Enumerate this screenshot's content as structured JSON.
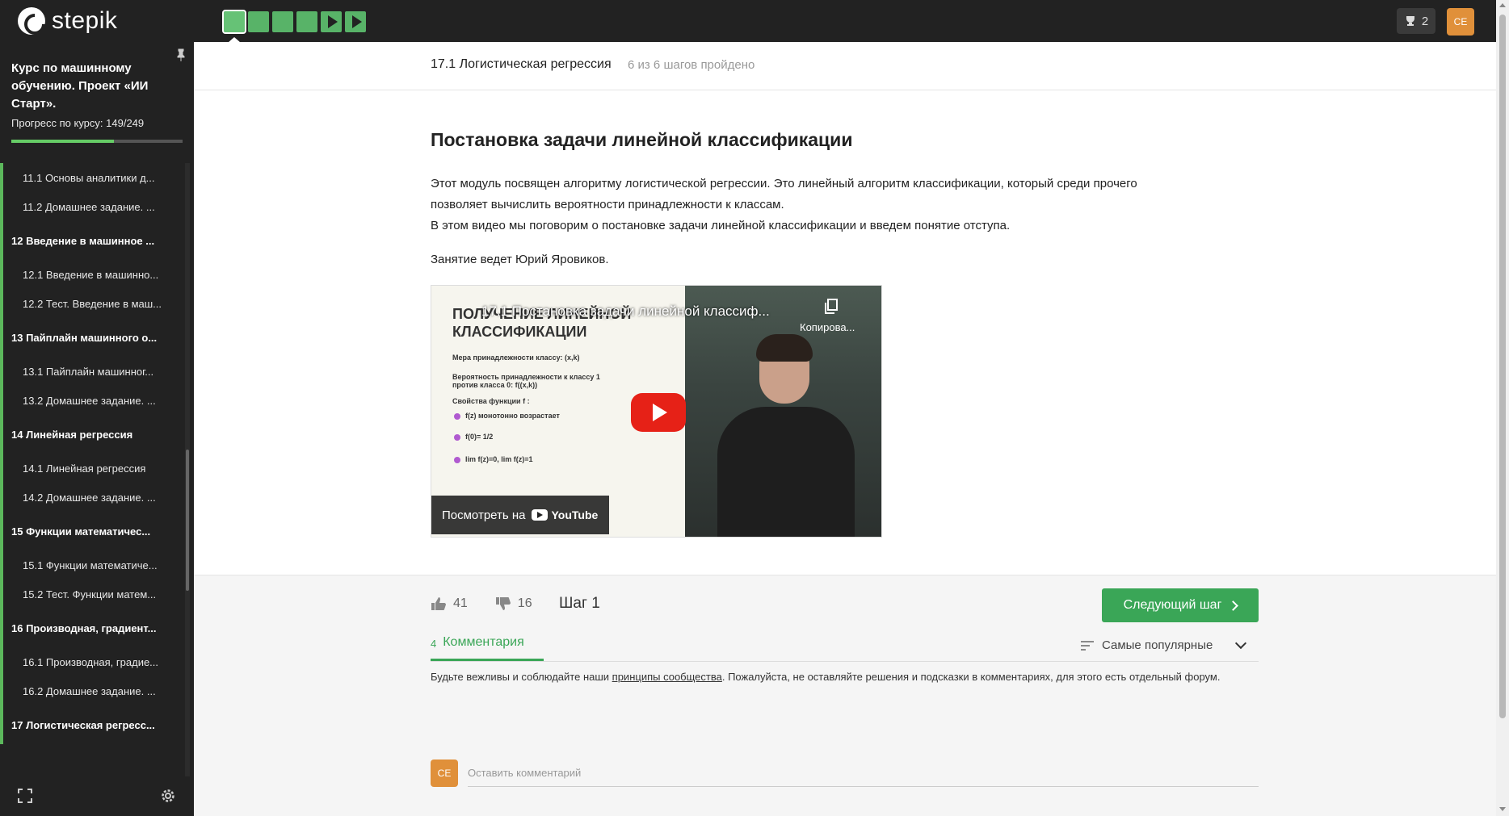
{
  "topbar": {
    "logo_text": "stepik",
    "steps": [
      {
        "kind": "text",
        "status": "done-active"
      },
      {
        "kind": "text",
        "status": "done"
      },
      {
        "kind": "text",
        "status": "done"
      },
      {
        "kind": "text",
        "status": "done"
      },
      {
        "kind": "video",
        "status": "done"
      },
      {
        "kind": "video",
        "status": "done"
      }
    ],
    "notifications_count": "2",
    "avatar_initials": "CE",
    "colors": {
      "bar": "#222222",
      "step_done": "#58b368",
      "avatar": "#e0903a"
    }
  },
  "sidebar": {
    "course_title": "Курс по машинному обучению. Проект «ИИ Старт».",
    "progress_label": "Прогресс по курсу:  149/249",
    "progress_fraction": 0.598,
    "toc": [
      {
        "type": "lesson",
        "label": "11.1  Основы аналитики д..."
      },
      {
        "type": "lesson",
        "label": "11.2  Домашнее задание. ..."
      },
      {
        "type": "module",
        "label": "12  Введение в машинное ..."
      },
      {
        "type": "lesson",
        "label": "12.1  Введение в машинно..."
      },
      {
        "type": "lesson",
        "label": "12.2  Тест. Введение в маш..."
      },
      {
        "type": "module",
        "label": "13  Пайплайн машинного о..."
      },
      {
        "type": "lesson",
        "label": "13.1  Пайплайн машинног..."
      },
      {
        "type": "lesson",
        "label": "13.2  Домашнее задание. ..."
      },
      {
        "type": "module",
        "label": "14  Линейная регрессия"
      },
      {
        "type": "lesson",
        "label": "14.1  Линейная регрессия"
      },
      {
        "type": "lesson",
        "label": "14.2  Домашнее задание. ..."
      },
      {
        "type": "module",
        "label": "15  Функции математичес..."
      },
      {
        "type": "lesson",
        "label": "15.1  Функции математиче..."
      },
      {
        "type": "lesson",
        "label": "15.2  Тест. Функции матем..."
      },
      {
        "type": "module",
        "label": "16  Производная, градиент..."
      },
      {
        "type": "lesson",
        "label": "16.1  Производная, градие..."
      },
      {
        "type": "lesson",
        "label": "16.2  Домашнее задание. ..."
      },
      {
        "type": "module",
        "label": "17  Логистическая регресс..."
      }
    ],
    "icons": {
      "pin": "pin-icon",
      "expand": "expand-icon",
      "settings": "gear-icon"
    }
  },
  "lesson_bar": {
    "title": "17.1 Логистическая регрессия",
    "progress": "6 из 6 шагов пройдено"
  },
  "step": {
    "title": "Постановка задачи линейной классификации",
    "paragraph1_line1": "Этот модуль посвящен алгоритму логистической регрессии. Это линейный алгоритм классификации, который среди прочего",
    "paragraph1_line2": "позволяет вычислить вероятности принадлежности к классам.",
    "paragraph1_line3": "В этом видео мы поговорим о постановке задачи линейной классификации и введем понятие отступа.",
    "paragraph2": "Занятие ведет Юрий Яровиков.",
    "video": {
      "title": "17.1 Постановка задачи линейной классиф...",
      "copy_label": "Копирова...",
      "watch_on": "Посмотреть на",
      "youtube": "YouTube",
      "slide_heading": "ПОЛУЧЕНИЕ ЛИНЕЙНОЙ КЛАССИФИКАЦИИ",
      "slide_lines": [
        "Мера принадлежности классу:  (x,k)",
        "Вероятность принадлежности к классу 1 против класса 0:  f((x,k))",
        "Свойства функции f :",
        "f(z)  монотонно возрастает",
        "f(0)= 1/2",
        "lim f(z)=0,  lim f(z)=1"
      ]
    }
  },
  "footer": {
    "likes": "41",
    "dislikes": "16",
    "step_label": "Шаг 1",
    "next_button": "Следующий шаг",
    "comments_count": "4",
    "comments_label": "Комментария",
    "sort_label": "Самые популярные",
    "notice_before": "Будьте вежливы и соблюдайте наши ",
    "notice_link": "принципы сообщества",
    "notice_after": ". Пожалуйста, не оставляйте решения и подсказки в комментариях, для этого есть отдельный форум.",
    "comment_avatar": "CE",
    "comment_placeholder": "Оставить комментарий",
    "colors": {
      "accent": "#3aa657"
    }
  }
}
